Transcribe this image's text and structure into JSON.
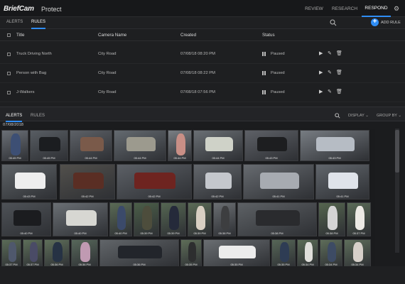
{
  "app": {
    "brand": "BriefCam",
    "product": "Protect"
  },
  "top_nav": [
    {
      "label": "REVIEW"
    },
    {
      "label": "RESEARCH"
    },
    {
      "label": "RESPOND",
      "active": true
    }
  ],
  "rules_bar": {
    "tabs": [
      {
        "label": "ALERTS"
      },
      {
        "label": "RULES",
        "active": true
      }
    ],
    "add_rule_label": "ADD RULE"
  },
  "rules_table": {
    "headers": {
      "title": "Title",
      "camera": "Camera Name",
      "created": "Created",
      "status": "Status"
    },
    "rows": [
      {
        "title": "Truck Driving North",
        "camera": "City Road",
        "created": "07/08/18 08:20 PM",
        "status": "Paused"
      },
      {
        "title": "Person with Bag",
        "camera": "City Road",
        "created": "07/08/18 08:22 PM",
        "status": "Paused"
      },
      {
        "title": "J-Walkers",
        "camera": "City Road",
        "created": "07/08/18 07:56 PM",
        "status": "Paused"
      }
    ]
  },
  "alerts_panel": {
    "tabs": [
      {
        "label": "ALERTS",
        "active": true
      },
      {
        "label": "RULES"
      }
    ],
    "display_label": "DISPLAY",
    "group_by_label": "GROUP BY",
    "date": "07/08/2018"
  },
  "thumbnails": [
    {
      "ts": "05:45 PM",
      "color": "#6b7077",
      "subject": "#3d4f74"
    },
    {
      "ts": "05:45 PM",
      "color": "#585d63",
      "subject": "#1b1d20"
    },
    {
      "ts": "05:44 PM",
      "color": "#5d6167",
      "subject": "#7a5a4a"
    },
    {
      "ts": "05:44 PM",
      "color": "#646a70",
      "subject": "#9c9a8e"
    },
    {
      "ts": "05:44 PM",
      "color": "#7a7f84",
      "subject": "#c98f86"
    },
    {
      "ts": "05:44 PM",
      "color": "#6a6f74",
      "subject": "#cfd2c8"
    },
    {
      "ts": "05:43 PM",
      "color": "#5e6167",
      "subject": "#1d1e20"
    },
    {
      "ts": "05:43 PM",
      "color": "#777c82",
      "subject": "#b6bcc4"
    },
    {
      "ts": "05:43 PM",
      "color": "#5f6468",
      "subject": "#eeeeee"
    },
    {
      "ts": "05:42 PM",
      "color": "#52504c",
      "subject": "#5a2e24"
    },
    {
      "ts": "05:42 PM",
      "color": "#5c6066",
      "subject": "#6e2420"
    },
    {
      "ts": "05:42 PM",
      "color": "#63676c",
      "subject": "#c4c7cc"
    },
    {
      "ts": "05:41 PM",
      "color": "#676b70",
      "subject": "#a7abb1"
    },
    {
      "ts": "05:41 PM",
      "color": "#61666c",
      "subject": "#dfe3ea"
    },
    {
      "ts": "05:40 PM",
      "color": "#4e5257",
      "subject": "#1b1c1f"
    },
    {
      "ts": "05:40 PM",
      "color": "#6a6f74",
      "subject": "#d7d7d2"
    },
    {
      "ts": "05:40 PM",
      "color": "#5a6a55",
      "subject": "#3b4a6a"
    },
    {
      "ts": "05:39 PM",
      "color": "#4b5e48",
      "subject": "#4d4d3c"
    },
    {
      "ts": "05:39 PM",
      "color": "#556652",
      "subject": "#252a3a"
    },
    {
      "ts": "05:39 PM",
      "color": "#5b6b56",
      "subject": "#d8cfc2"
    },
    {
      "ts": "05:38 PM",
      "color": "#6a6e72",
      "subject": "#3d3e40"
    },
    {
      "ts": "05:38 PM",
      "color": "#5d6165",
      "subject": "#2a2b2e"
    },
    {
      "ts": "05:38 PM",
      "color": "#55654f",
      "subject": "#d4d4d4"
    },
    {
      "ts": "05:37 PM",
      "color": "#5a6b57",
      "subject": "#eceae4"
    },
    {
      "ts": "05:37 PM",
      "color": "#5a6b57",
      "subject": "#4f586c"
    },
    {
      "ts": "05:37 PM",
      "color": "#5d6e59",
      "subject": "#4a4b66"
    },
    {
      "ts": "05:36 PM",
      "color": "#5f6f5a",
      "subject": "#263244"
    },
    {
      "ts": "05:36 PM",
      "color": "#57675a",
      "subject": "#c09ab2"
    },
    {
      "ts": "05:36 PM",
      "color": "#616569",
      "subject": "#22252b"
    },
    {
      "ts": "05:35 PM",
      "color": "#5e6d58",
      "subject": "#2d2e2f"
    },
    {
      "ts": "05:35 PM",
      "color": "#6a6e72",
      "subject": "#ececec"
    },
    {
      "ts": "05:35 PM",
      "color": "#566657",
      "subject": "#2e3c54"
    },
    {
      "ts": "05:34 PM",
      "color": "#5a6b56",
      "subject": "#e0dfdb"
    },
    {
      "ts": "05:34 PM",
      "color": "#5d6c59",
      "subject": "#3d4b64"
    },
    {
      "ts": "05:34 PM",
      "color": "#5e6e5b",
      "subject": "#d6d0c9"
    }
  ],
  "colors": {
    "accent": "#2f8df5",
    "background": "#1b1c1e"
  },
  "icons": [
    "search-icon",
    "gear-icon",
    "add-icon",
    "play-icon",
    "edit-icon",
    "delete-icon",
    "pause-icon",
    "checkbox-icon"
  ]
}
